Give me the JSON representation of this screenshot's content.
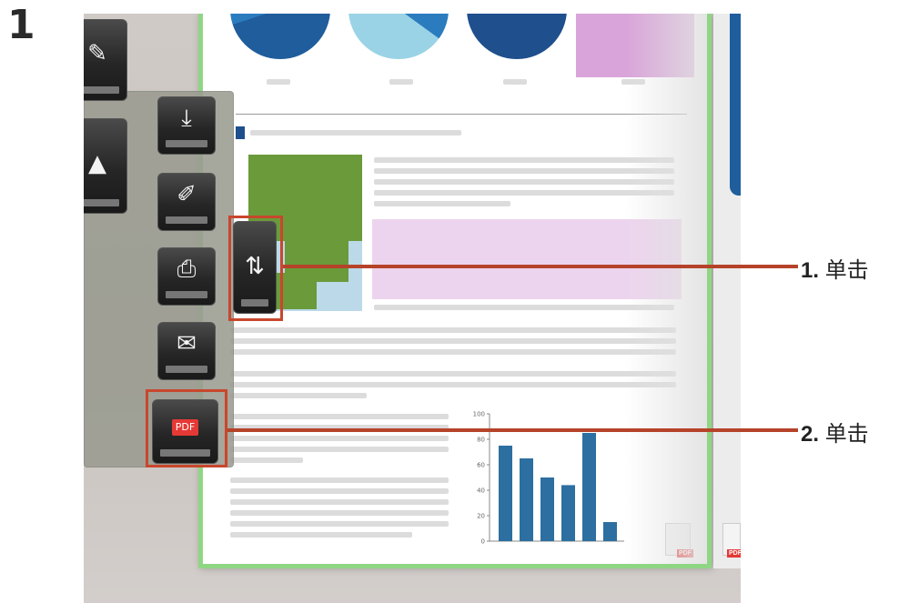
{
  "step": {
    "number": "1"
  },
  "toolbar": {
    "buttons": [
      {
        "id": "highlighter",
        "icon": "highlighter-icon",
        "glyph": "✎"
      },
      {
        "id": "image",
        "icon": "image-icon",
        "glyph": "▲"
      }
    ],
    "menu": [
      {
        "id": "save-inbox",
        "icon": "inbox-download-icon",
        "glyph": "⤓"
      },
      {
        "id": "edit-save",
        "icon": "inbox-edit-icon",
        "glyph": "✐"
      },
      {
        "id": "print",
        "icon": "printer-icon",
        "glyph": "⎙"
      },
      {
        "id": "email",
        "icon": "envelope-icon",
        "glyph": "✉"
      },
      {
        "id": "export-pdf",
        "icon": "pdf-upload-icon",
        "glyph": "PDF"
      }
    ],
    "transfer": {
      "icon": "transfer-icon",
      "glyph": "⇅"
    }
  },
  "callouts": [
    {
      "num": "1.",
      "text": "单击"
    },
    {
      "num": "2.",
      "text": "单击"
    }
  ],
  "chart_data": {
    "type": "bar",
    "values": [
      75,
      65,
      50,
      44,
      85,
      15
    ],
    "ylim": [
      0,
      100
    ],
    "yticks": [
      "100",
      "80",
      "60",
      "40",
      "20",
      "0"
    ],
    "color": "#2d6fa0"
  },
  "pdf_badge": "PDF",
  "colors": {
    "accent": "#c8472d",
    "page_border": "#8fd684",
    "bar": "#2d6fa0"
  }
}
